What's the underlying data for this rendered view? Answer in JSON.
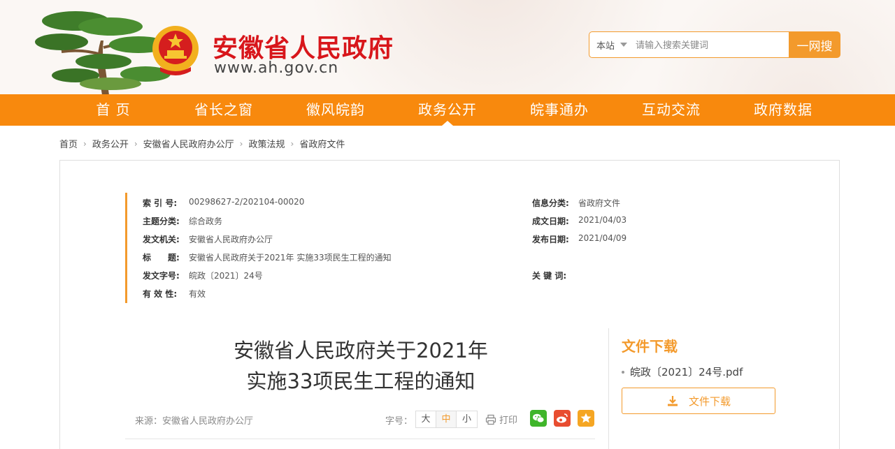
{
  "header": {
    "site_title": "安徽省人民政府",
    "site_url": "www.ah.gov.cn",
    "search": {
      "scope": "本站",
      "placeholder": "请输入搜索关键词",
      "button": "一网搜"
    }
  },
  "nav": {
    "items": [
      {
        "label": "首 页"
      },
      {
        "label": "省长之窗"
      },
      {
        "label": "徽风皖韵"
      },
      {
        "label": "政务公开"
      },
      {
        "label": "皖事通办"
      },
      {
        "label": "互动交流"
      },
      {
        "label": "政府数据"
      }
    ],
    "active_index": 3
  },
  "breadcrumb": [
    "首页",
    "政务公开",
    "安徽省人民政府办公厅",
    "政策法规",
    "省政府文件"
  ],
  "meta": {
    "index_no_key": "索 引 号:",
    "index_no": "00298627-2/202104-00020",
    "info_class_key": "信息分类:",
    "info_class": "省政府文件",
    "topic_key": "主题分类:",
    "topic": "综合政务",
    "written_date_key": "成文日期:",
    "written_date": "2021/04/03",
    "issuer_key": "发文机关:",
    "issuer": "安徽省人民政府办公厅",
    "publish_date_key": "发布日期:",
    "publish_date": "2021/04/09",
    "title_key": "标　　题:",
    "title": "安徽省人民政府关于2021年 实施33项民生工程的通知",
    "doc_no_key": "发文字号:",
    "doc_no": "皖政〔2021〕24号",
    "keywords_key": "关 键 词:",
    "keywords": "",
    "validity_key": "有 效 性:",
    "validity": "有效"
  },
  "article": {
    "title_line1": "安徽省人民政府关于2021年",
    "title_line2": "实施33项民生工程的通知",
    "source": "来源：安徽省人民政府办公厅",
    "font_size_label": "字号：",
    "font_sizes": [
      "大",
      "中",
      "小"
    ],
    "print_label": "打印"
  },
  "download": {
    "title": "文件下载",
    "file_name": "皖政〔2021〕24号.pdf",
    "button": "文件下载"
  },
  "colors": {
    "brand_orange": "#f8890d",
    "accent_orange": "#f39a2c",
    "title_red": "#d8161b"
  }
}
